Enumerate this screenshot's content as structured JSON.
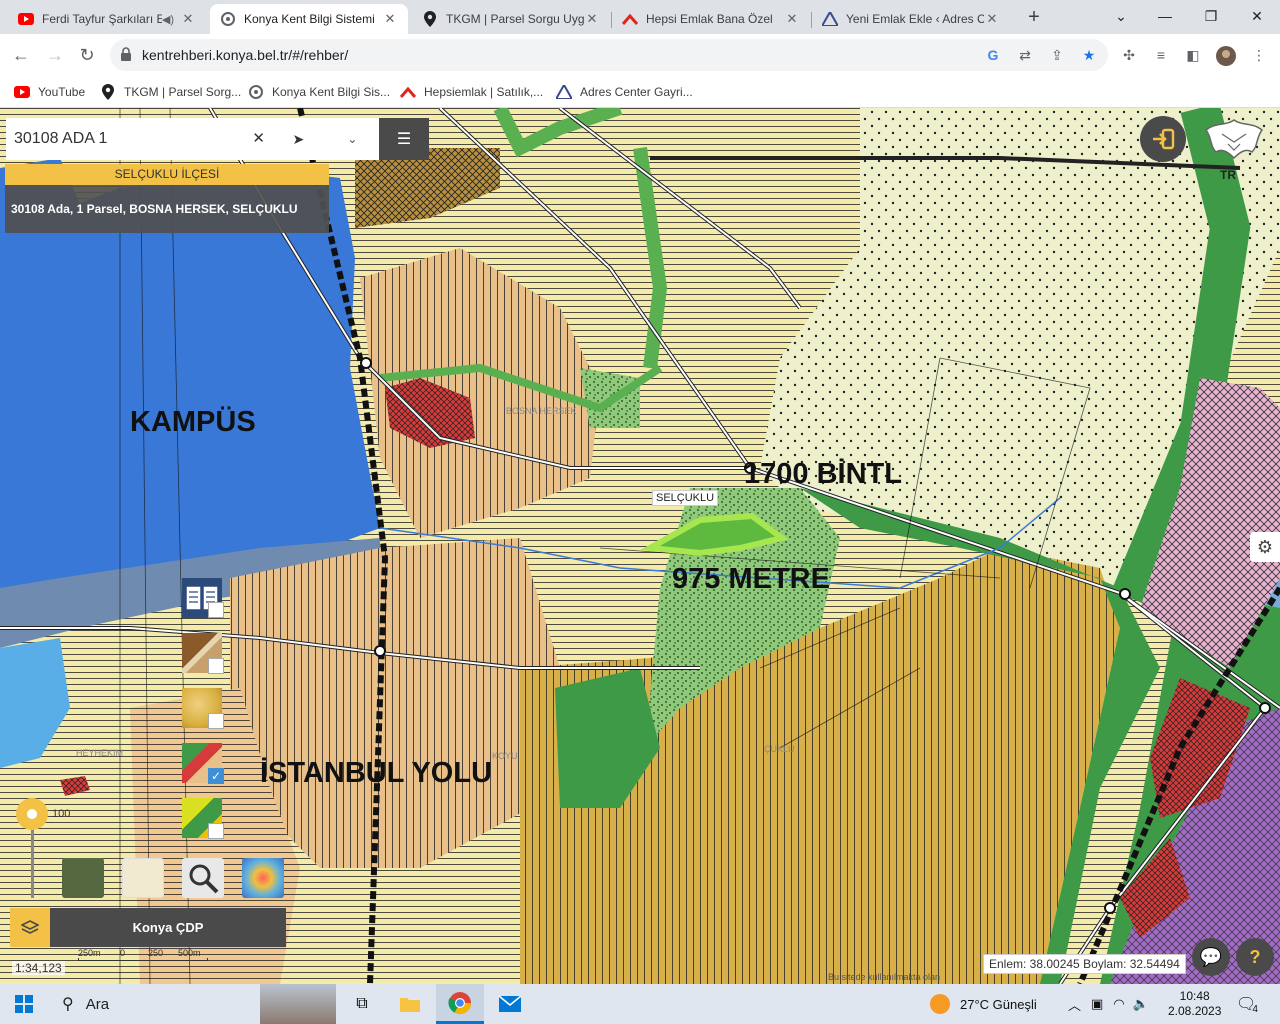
{
  "browser": {
    "tabs": [
      {
        "title": "Ferdi Tayfur Şarkıları E",
        "icon": "youtube-icon",
        "active": false
      },
      {
        "title": "Konya Kent Bilgi Sistemi",
        "icon": "kbs-icon",
        "active": true
      },
      {
        "title": "TKGM | Parsel Sorgu Uyg",
        "icon": "location-pin-icon",
        "active": false
      },
      {
        "title": "Hepsi Emlak Bana Özel",
        "icon": "hepsiemlak-icon",
        "active": false
      },
      {
        "title": "Yeni Emlak Ekle ‹ Adres Ce",
        "icon": "adres-center-icon",
        "active": false
      }
    ],
    "new_tab_label": "+",
    "url": "kentrehberi.konya.bel.tr/#/rehber/",
    "bookmarks": [
      {
        "label": "YouTube",
        "icon": "youtube-icon"
      },
      {
        "label": "TKGM | Parsel Sorg...",
        "icon": "location-pin-icon"
      },
      {
        "label": "Konya Kent Bilgi Sis...",
        "icon": "kbs-icon"
      },
      {
        "label": "Hepsiemlak | Satılık,...",
        "icon": "hepsiemlak-icon"
      },
      {
        "label": "Adres Center Gayri...",
        "icon": "adres-center-icon"
      }
    ]
  },
  "map_app": {
    "search_value": "30108 ADA 1",
    "district": "SELÇUKLU İLÇESİ",
    "parcel_info": "30108 Ada, 1 Parsel, BOSNA HERSEK, SELÇUKLU",
    "annotations": {
      "kampus": "KAMPÜS",
      "distance1": "1700 BİNTL",
      "distance2": "975 METRE",
      "istanbul_yolu": "İSTANBUL YOLU"
    },
    "selcuklu_label": "SELÇUKLU",
    "faint_labels": {
      "bosna": "BOSNA HERSEK",
      "hekim": "HEYHEKIM",
      "koyu": "KOYU",
      "selcuklu2": "ÇUKLU"
    },
    "logo_text": "TR",
    "zoom_value": "100",
    "layer_name": "Konya ÇDP",
    "scale": "1:34,123",
    "scalebar_labels": [
      "250m",
      "0",
      "250",
      "500m"
    ],
    "coords": "Enlem: 38.00245 Boylam: 32.54494",
    "copyright": "Bu sitede kullanılmakta olan"
  },
  "taskbar": {
    "search_placeholder": "Ara",
    "weather": "27°C  Güneşli",
    "time": "10:48",
    "date": "2.08.2023",
    "notification_count": "4"
  }
}
